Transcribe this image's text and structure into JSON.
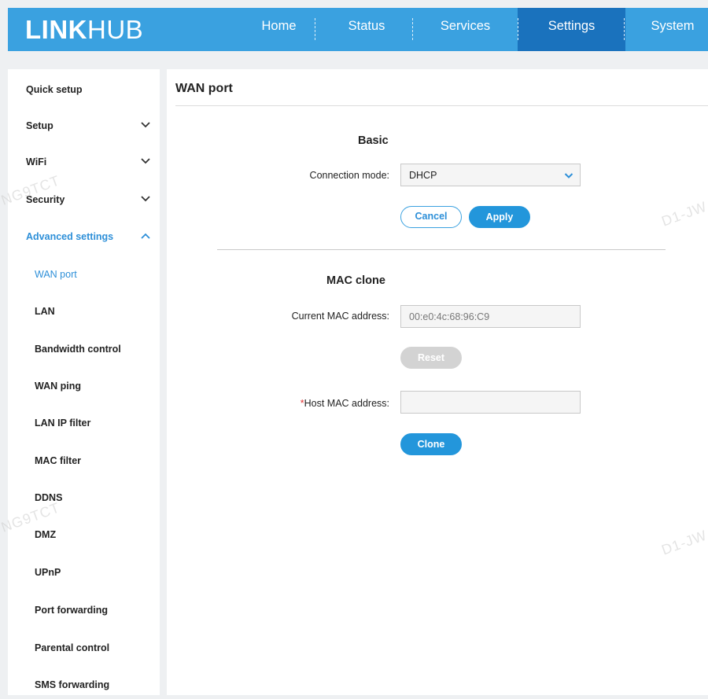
{
  "app": {
    "logo_bold": "LINK",
    "logo_light": "HUB"
  },
  "nav": {
    "items": [
      {
        "label": "Home"
      },
      {
        "label": "Status"
      },
      {
        "label": "Services"
      },
      {
        "label": "Settings"
      },
      {
        "label": "System"
      }
    ],
    "active_index": 3
  },
  "sidebar": {
    "items": [
      {
        "label": "Quick setup"
      },
      {
        "label": "Setup"
      },
      {
        "label": "WiFi"
      },
      {
        "label": "Security"
      },
      {
        "label": "Advanced settings"
      }
    ],
    "subitems": [
      {
        "label": "WAN port"
      },
      {
        "label": "LAN"
      },
      {
        "label": "Bandwidth control"
      },
      {
        "label": "WAN ping"
      },
      {
        "label": "LAN IP filter"
      },
      {
        "label": "MAC filter"
      },
      {
        "label": "DDNS"
      },
      {
        "label": "DMZ"
      },
      {
        "label": "UPnP"
      },
      {
        "label": "Port forwarding"
      },
      {
        "label": "Parental control"
      },
      {
        "label": "SMS forwarding"
      }
    ]
  },
  "main": {
    "title": "WAN port",
    "basic": {
      "section_title": "Basic",
      "connection_mode_label": "Connection mode:",
      "connection_mode_value": "DHCP",
      "cancel_label": "Cancel",
      "apply_label": "Apply"
    },
    "mac_clone": {
      "section_title": "MAC clone",
      "current_mac_label": "Current MAC address:",
      "current_mac_value": "00:e0:4c:68:96:C9",
      "reset_label": "Reset",
      "required_mark": "*",
      "host_mac_label": "Host MAC address:",
      "host_mac_value": "",
      "clone_label": "Clone"
    }
  },
  "watermarks": {
    "left_top": "NG9TCT",
    "left_bottom": "NG9TCT",
    "right_top": "D1-JW",
    "right_bottom": "D1-JW"
  },
  "colors": {
    "header_blue": "#3aa1e0",
    "active_tab": "#1a72bd",
    "accent": "#2d8fd8",
    "required": "#e03030"
  }
}
